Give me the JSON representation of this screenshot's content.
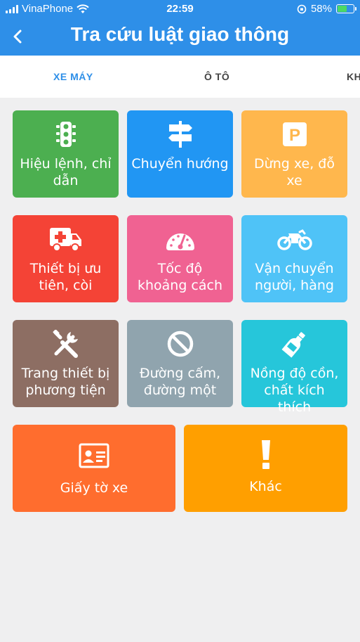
{
  "status_bar": {
    "carrier": "VinaPhone",
    "time": "22:59",
    "battery": "58%",
    "battery_level": 0.58
  },
  "header": {
    "back_label": "<",
    "title": "Tra cứu luật giao thông"
  },
  "tabs": [
    {
      "label": "XE MÁY",
      "active": true
    },
    {
      "label": "Ô TÔ",
      "active": false
    },
    {
      "label": "KH",
      "active": false
    }
  ],
  "tiles": [
    {
      "label": "Hiệu lệnh, chỉ dẫn",
      "icon": "traffic-light-icon",
      "color": "#4caf50"
    },
    {
      "label": "Chuyển hướng",
      "icon": "signpost-icon",
      "color": "#2196f3"
    },
    {
      "label": "Dừng xe, đỗ xe",
      "icon": "parking-icon",
      "color": "#ffb74d"
    },
    {
      "label": "Thiết bị ưu tiên, còi",
      "icon": "ambulance-icon",
      "color": "#f44336"
    },
    {
      "label": "Tốc độ khoảng cách",
      "icon": "speedometer-icon",
      "color": "#f06292"
    },
    {
      "label": "Vận chuyển người, hàng",
      "icon": "motorcycle-icon",
      "color": "#4fc3f7"
    },
    {
      "label": "Trang thiết bị phương tiện",
      "icon": "tools-icon",
      "color": "#8d6e63"
    },
    {
      "label": "Đường cấm, đường một",
      "icon": "prohibited-icon",
      "color": "#90a4ae"
    },
    {
      "label": "Nồng độ cồn, chất kích thích",
      "icon": "bottle-icon",
      "color": "#26c6da"
    },
    {
      "label": "Giấy tờ xe",
      "icon": "id-card-icon",
      "color": "#ff6d2e"
    },
    {
      "label": "Khác",
      "icon": "exclamation-icon",
      "color": "#ff9f00"
    }
  ]
}
